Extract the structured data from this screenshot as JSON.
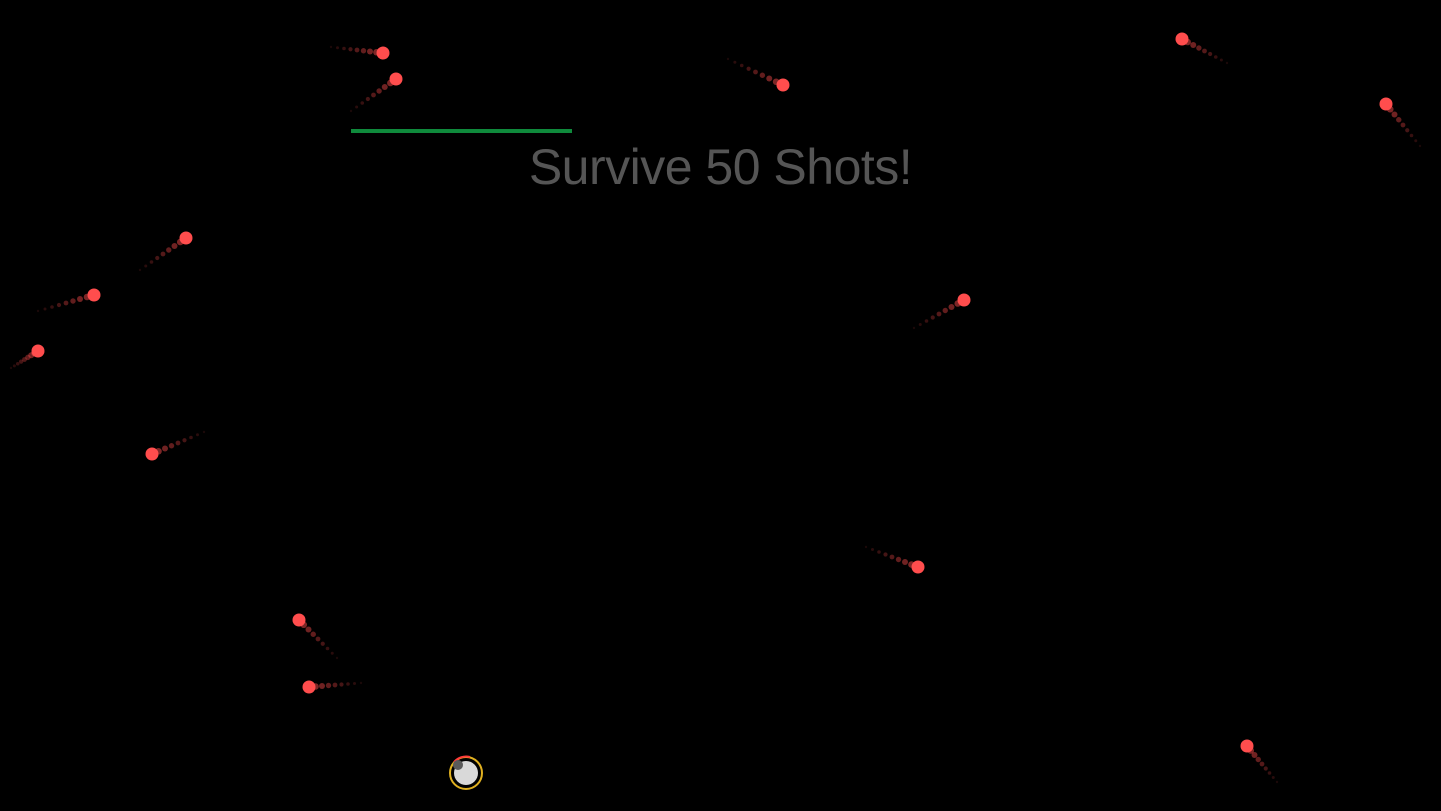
{
  "hud": {
    "objective_text": "Survive 50 Shots!",
    "progress_fraction": 1.0,
    "progress_color": "#0f8a3c"
  },
  "colors": {
    "background": "#000000",
    "bullet": "#ff4d4d",
    "player_body": "#d9d9d9",
    "player_ring": "#e0b020",
    "player_damage_arc": "#ff3b3b"
  },
  "entities": {
    "player": {
      "icon": "player-orb-icon"
    },
    "projectile_icon": "red-bullet-icon"
  }
}
